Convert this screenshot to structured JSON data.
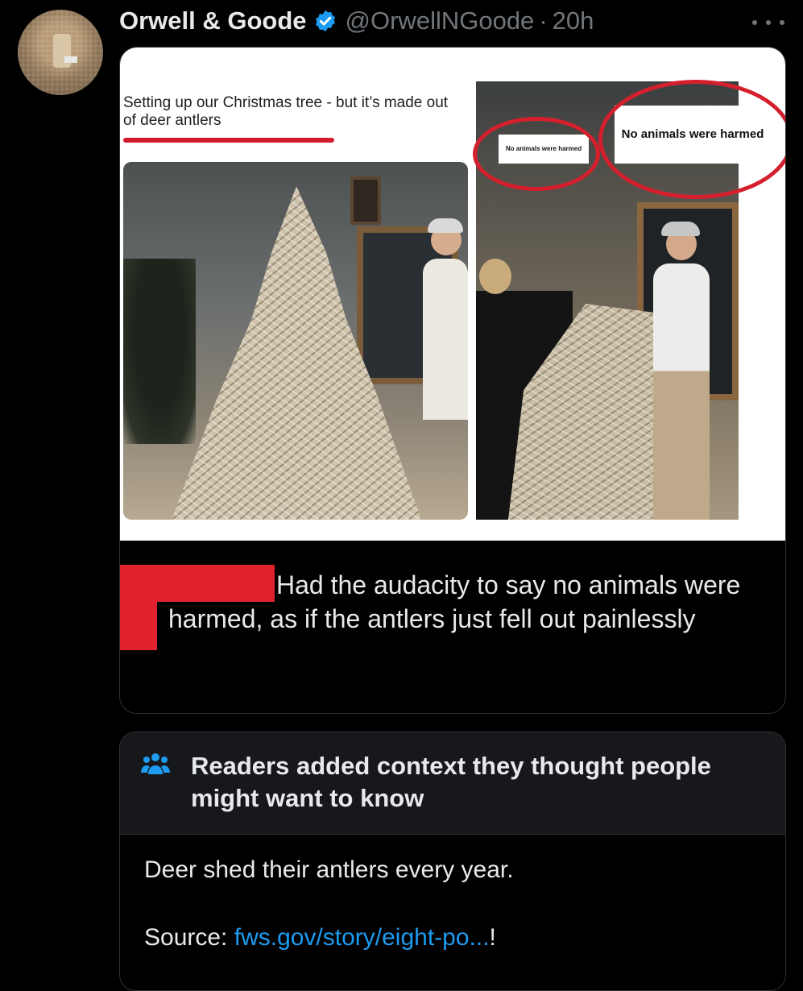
{
  "author": {
    "name": "Orwell & Goode",
    "handle": "@OrwellNGoode",
    "separator": "·",
    "time": "20h",
    "verified_color": "#1d9bf0"
  },
  "media": {
    "embedded_tweet_text": "Setting up our Christmas tree - but it’s made out of deer antlers",
    "sticker_small": "No animals were harmed",
    "sticker_big": "No animals were harmed",
    "caption": "Had the audacity to say no animals were harmed, as if the antlers just fell out painlessly",
    "highlight_color": "#d61f2c"
  },
  "context": {
    "title": "Readers added context they thought people might want to know",
    "body": "Deer shed their antlers every year.",
    "source_label": "Source: ",
    "source_link": "fws.gov/story/eight-po...",
    "source_suffix": "!",
    "link_color": "#1d9bf0"
  },
  "icons": {
    "more": "more-dots-icon",
    "verified": "verified-badge-icon",
    "people": "people-icon"
  }
}
